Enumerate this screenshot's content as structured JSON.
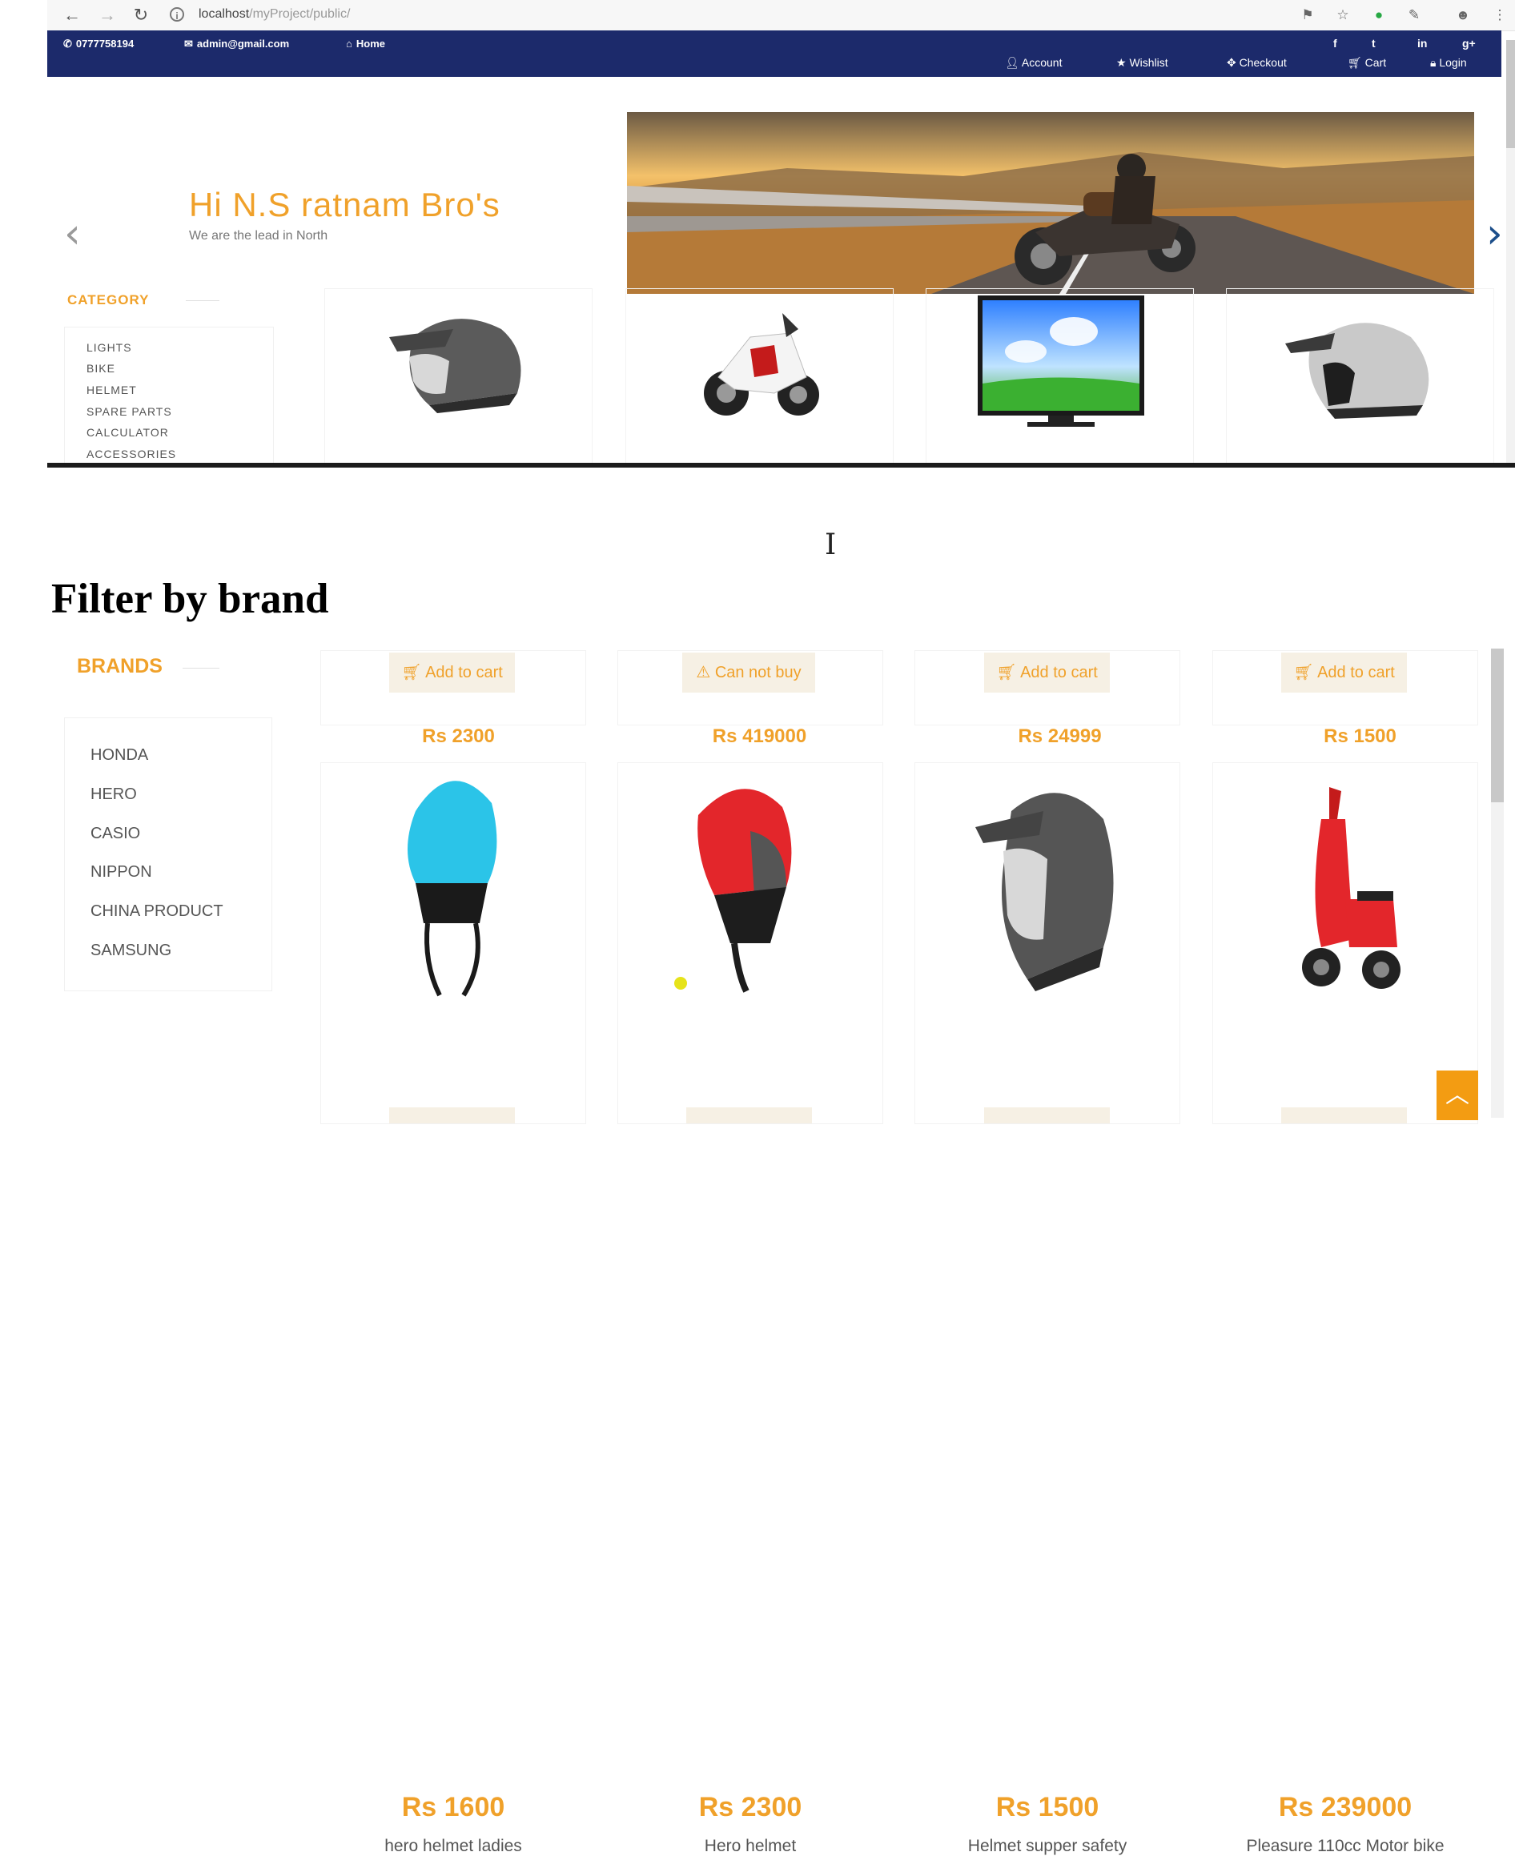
{
  "browser": {
    "url_host": "localhost",
    "url_path": "/myProject/public/"
  },
  "header": {
    "phone": "0777758194",
    "email": "admin@gmail.com",
    "home": "Home",
    "social": [
      "f",
      "t",
      "in",
      "g+"
    ],
    "account": "Account",
    "wishlist": "Wishlist",
    "checkout": "Checkout",
    "cart": "Cart",
    "login": "Login"
  },
  "slider": {
    "title": "Hi N.S ratnam Bro's",
    "subtitle": "We are the lead in North"
  },
  "category": {
    "title": "CATEGORY",
    "items": [
      "LIGHTS",
      "BIKE",
      "HELMET",
      "SPARE PARTS",
      "CALCULATOR",
      "ACCESSORIES"
    ]
  },
  "featured": [
    {
      "price": "Rs 2300",
      "image": "helmet-icon"
    },
    {
      "price": "Rs 419000",
      "image": "motorbike-icon"
    },
    {
      "price": "Rs 24999",
      "image": "tv-icon"
    },
    {
      "price": "Rs 1500",
      "image": "helmet-icon"
    }
  ],
  "filter_heading": "Filter by brand",
  "brands": {
    "title": "BRANDS",
    "items": [
      "HONDA",
      "HERO",
      "CASIO",
      "NIPPON",
      "CHINA PRODUCT",
      "SAMSUNG"
    ]
  },
  "top_row_buttons": [
    {
      "label": "Add to cart",
      "icon": "cart-icon"
    },
    {
      "label": "Can not buy",
      "icon": "warning-icon"
    },
    {
      "label": "Add to cart",
      "icon": "cart-icon"
    },
    {
      "label": "Add to cart",
      "icon": "cart-icon"
    }
  ],
  "products": [
    {
      "price": "Rs 1600",
      "name": "hero helmet ladies"
    },
    {
      "price": "Rs 2300",
      "name": "Hero helmet"
    },
    {
      "price": "Rs 1500",
      "name": "Helmet supper safety"
    },
    {
      "price": "Rs 239000",
      "name": "Pleasure 110cc Motor bike"
    }
  ],
  "colors": {
    "accent": "#f0a12a",
    "header_bg": "#1c2a6b",
    "button_bg": "#f6f0e4"
  }
}
